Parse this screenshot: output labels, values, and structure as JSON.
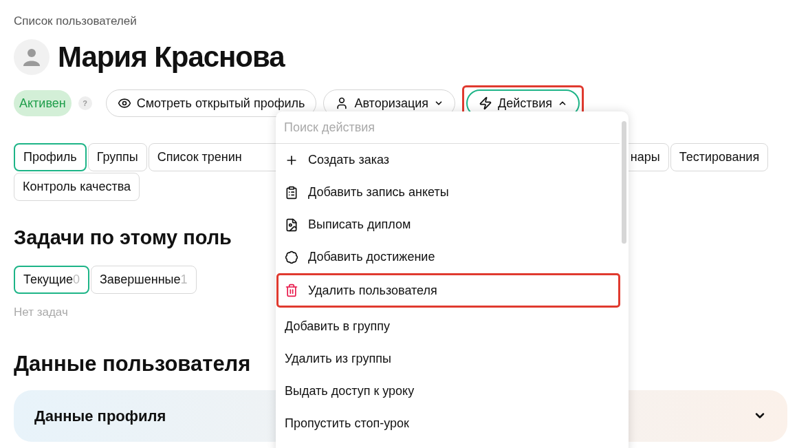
{
  "breadcrumb": "Список пользователей",
  "user": {
    "name": "Мария Краснова"
  },
  "status": {
    "label": "Активен",
    "help": "?"
  },
  "header_buttons": [
    {
      "kind": "view",
      "label": "Смотреть открытый профиль",
      "active": false,
      "highlighted": false
    },
    {
      "kind": "auth",
      "label": "Авторизация",
      "active": false,
      "highlighted": false
    },
    {
      "kind": "actions",
      "label": "Действия",
      "active": true,
      "highlighted": true
    }
  ],
  "tabs": [
    {
      "label": "Профиль",
      "selected": true
    },
    {
      "label": "Группы",
      "selected": false
    },
    {
      "label": "Список тренин",
      "selected": false
    },
    {
      "label": "нары",
      "selected": false
    },
    {
      "label": "Тестирования",
      "selected": false
    },
    {
      "label": "Контроль качества",
      "selected": false
    }
  ],
  "tasks": {
    "title": "Задачи по этому поль",
    "tabs": [
      {
        "label": "Текущие",
        "count": "0",
        "selected": true
      },
      {
        "label": "Завершенные",
        "count": "1",
        "selected": false
      }
    ],
    "empty": "Нет задач"
  },
  "user_data": {
    "title": "Данные пользователя",
    "section": {
      "title": "Данные профиля",
      "expanded": false
    }
  },
  "actions_menu": {
    "placeholder": "Поиск действия",
    "items": [
      {
        "kind": "icon",
        "label": "Создать заказ",
        "highlighted": false
      },
      {
        "kind": "icon",
        "label": "Добавить запись анкеты",
        "highlighted": false
      },
      {
        "kind": "icon",
        "label": "Выписать диплом",
        "highlighted": false
      },
      {
        "kind": "icon",
        "label": "Добавить достижение",
        "highlighted": false
      },
      {
        "kind": "danger",
        "label": "Удалить пользователя",
        "highlighted": true
      },
      {
        "kind": "plain",
        "label": "Добавить в группу",
        "highlighted": false
      },
      {
        "kind": "plain",
        "label": "Удалить из группы",
        "highlighted": false
      },
      {
        "kind": "plain",
        "label": "Выдать доступ к уроку",
        "highlighted": false
      },
      {
        "kind": "plain",
        "label": "Пропустить стоп-урок",
        "highlighted": false
      }
    ]
  }
}
